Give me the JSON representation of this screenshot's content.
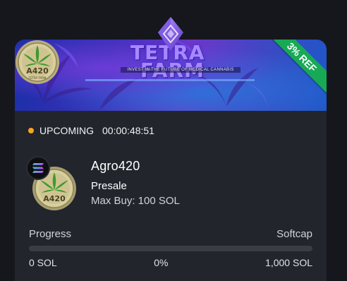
{
  "card": {
    "banner": {
      "title_line1": "TETRA",
      "title_line2": "FARM",
      "tagline": "INVEST IN THE FUTURE OF MEDICAL CANNABIS",
      "ref_ribbon": "3% REF",
      "coin_text": "A420",
      "coin_subtext": "TETRA FARM"
    },
    "status": {
      "label": "UPCOMING",
      "timer": "00:00:48:51",
      "color": "#f5a623"
    },
    "token": {
      "name": "Agro420",
      "type": "Presale",
      "max_buy": "Max Buy: 100 SOL",
      "chain_icon": "solana-icon",
      "coin_text": "A420"
    },
    "progress": {
      "label_left": "Progress",
      "label_right": "Softcap",
      "fraction": 0,
      "raised": "0 SOL",
      "percent": "0%",
      "softcap": "1,000 SOL",
      "track_color": "#3a3d45",
      "fill_color": "#18a957"
    }
  }
}
